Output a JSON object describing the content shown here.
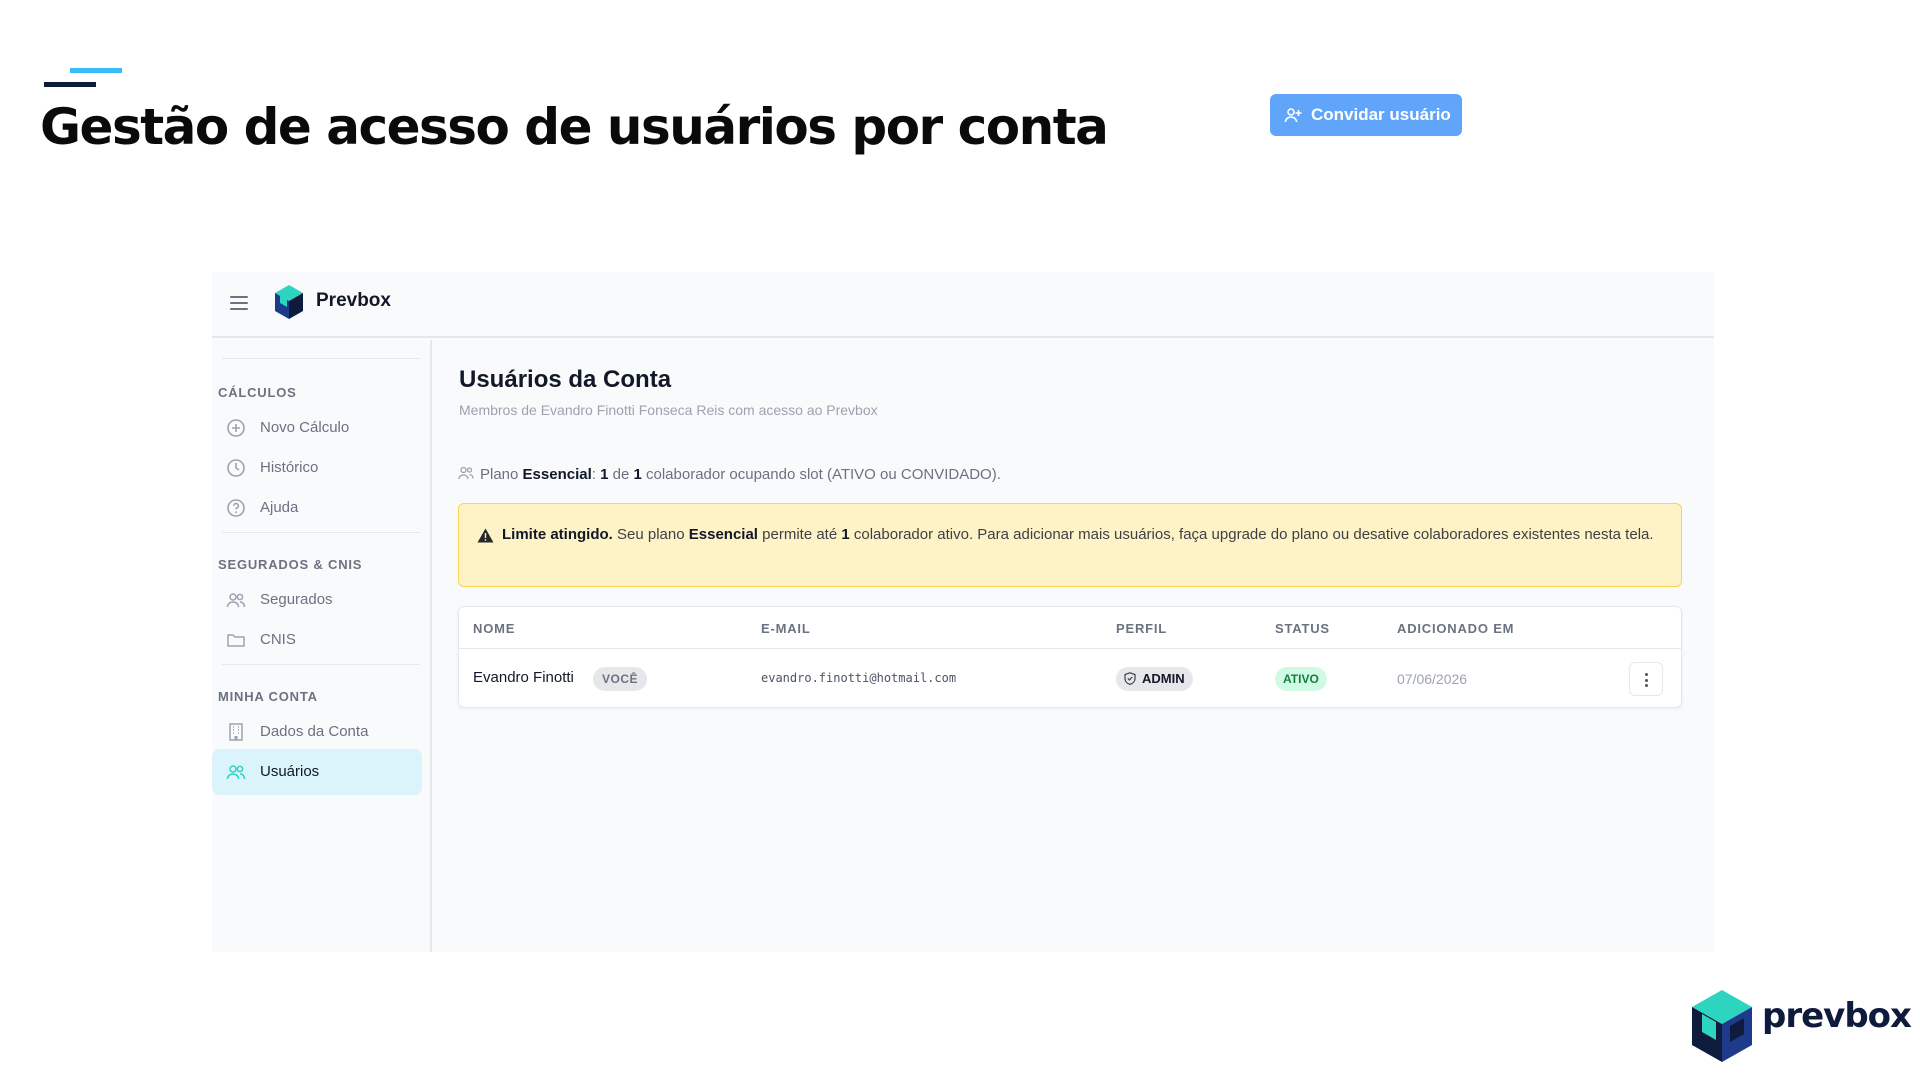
{
  "slide": {
    "title": "Gestão de acesso de usuários por conta",
    "footer_brand": "prevbox"
  },
  "app": {
    "brand": "Prevbox",
    "colors": {
      "accent": "#60a5fa",
      "active_bg": "#dbf3fa",
      "brand_teal": "#2dd4bf",
      "brand_navy": "#0f1b3d"
    }
  },
  "sidebar": {
    "sections": [
      {
        "label": "CÁLCULOS",
        "items": [
          {
            "label": "Novo Cálculo",
            "icon": "plus-circle-icon"
          },
          {
            "label": "Histórico",
            "icon": "clock-icon"
          },
          {
            "label": "Ajuda",
            "icon": "help-circle-icon"
          }
        ]
      },
      {
        "label": "SEGURADOS & CNIS",
        "items": [
          {
            "label": "Segurados",
            "icon": "users-icon"
          },
          {
            "label": "CNIS",
            "icon": "folder-icon"
          }
        ]
      },
      {
        "label": "MINHA CONTA",
        "items": [
          {
            "label": "Dados da Conta",
            "icon": "building-icon"
          },
          {
            "label": "Usuários",
            "icon": "users-icon",
            "active": true
          }
        ]
      }
    ]
  },
  "main": {
    "title": "Usuários da Conta",
    "subtitle": "Membros de Evandro Finotti Fonseca Reis com acesso ao Prevbox",
    "invite_button": "Convidar usuário",
    "plan": {
      "prefix": "Plano",
      "plan_name": "Essencial",
      "sep": ":",
      "used": "1",
      "of": "de",
      "total": "1",
      "suffix": "colaborador ocupando slot (ATIVO ou CONVIDADO)."
    },
    "alert": {
      "strong": "Limite atingido.",
      "text1": "Seu plano",
      "plan_name": "Essencial",
      "text2": "permite até",
      "count": "1",
      "text3": "colaborador ativo. Para adicionar mais usuários, faça upgrade do plano ou desative colaboradores existentes nesta tela."
    },
    "table": {
      "headers": [
        "NOME",
        "E-MAIL",
        "PERFIL",
        "STATUS",
        "ADICIONADO EM"
      ],
      "rows": [
        {
          "name": "Evandro Finotti",
          "you_badge": "VOCÊ",
          "email": "evandro.finotti@hotmail.com",
          "role": "ADMIN",
          "status": "ATIVO",
          "added": "07/06/2026"
        }
      ]
    }
  }
}
